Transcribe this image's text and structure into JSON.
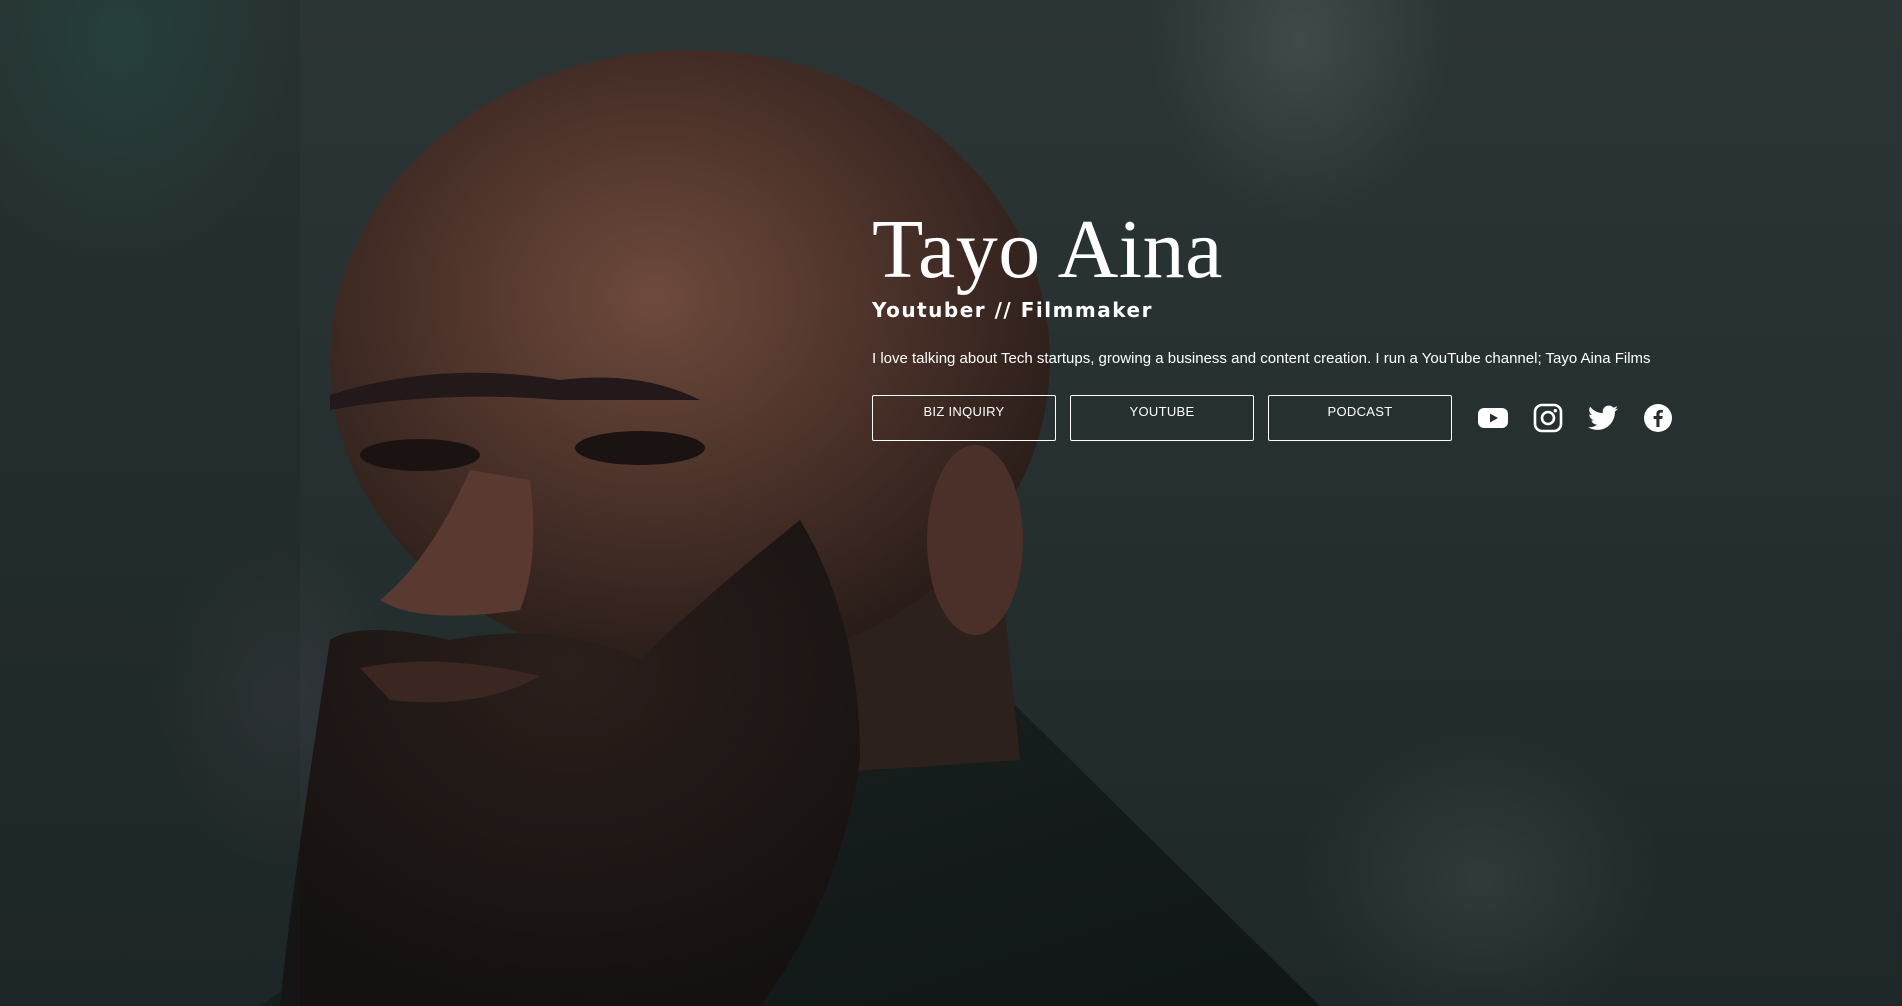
{
  "profile": {
    "name": "Tayo Aina",
    "role": "Youtuber // Filmmaker",
    "bio": "I love talking about Tech startups, growing a business and content creation. I run a YouTube channel; Tayo Aina Films"
  },
  "buttons": {
    "biz_inquiry": "BIZ INQUIRY",
    "youtube": "YOUTUBE",
    "podcast": "PODCAST"
  },
  "social_icons": [
    "youtube-icon",
    "instagram-icon",
    "twitter-icon",
    "facebook-icon"
  ],
  "colors": {
    "text": "#ffffff",
    "background": "#263030"
  }
}
